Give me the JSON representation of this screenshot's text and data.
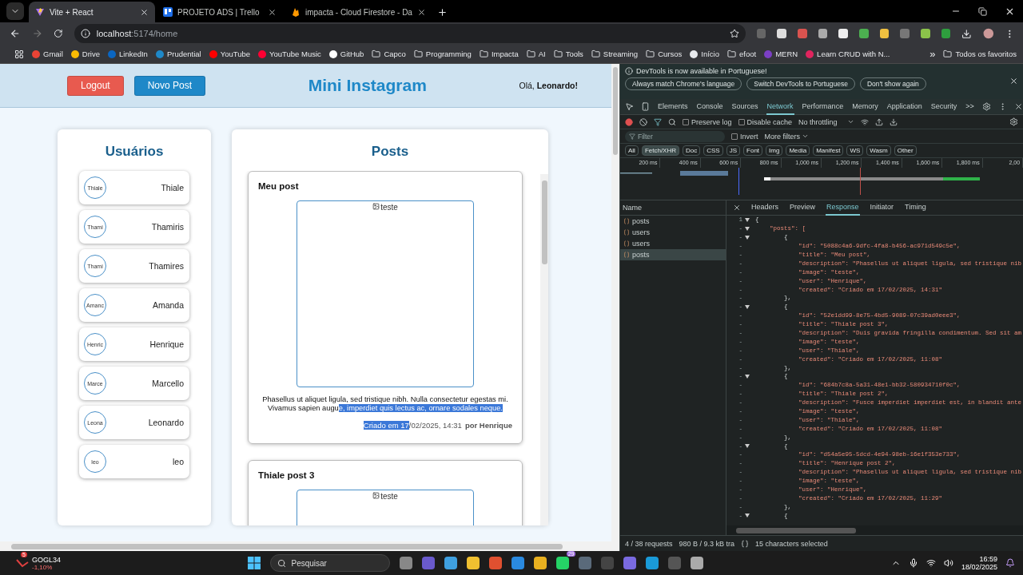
{
  "browser": {
    "tabs": [
      {
        "title": "Vite + React",
        "selected": true,
        "kind": "vite"
      },
      {
        "title": "PROJETO ADS | Trello",
        "selected": false,
        "kind": "trello"
      },
      {
        "title": "impacta - Cloud Firestore - Da",
        "selected": false,
        "kind": "firebase"
      }
    ],
    "address": {
      "host": "localhost",
      "path": ":5174/home"
    },
    "bookmarks": [
      {
        "label": "Gmail",
        "kind": "site",
        "color": "#ea4335"
      },
      {
        "label": "Drive",
        "kind": "site",
        "color": "#fbbc04"
      },
      {
        "label": "LinkedIn",
        "kind": "site",
        "color": "#0a66c2"
      },
      {
        "label": "Prudential",
        "kind": "site",
        "color": "#1e88c8"
      },
      {
        "label": "YouTube",
        "kind": "site",
        "color": "#ff0000"
      },
      {
        "label": "YouTube Music",
        "kind": "site",
        "color": "#ff0033"
      },
      {
        "label": "GitHub",
        "kind": "site",
        "color": "#ffffff"
      },
      {
        "label": "Capco",
        "kind": "folder"
      },
      {
        "label": "Programming",
        "kind": "folder"
      },
      {
        "label": "Impacta",
        "kind": "folder"
      },
      {
        "label": "AI",
        "kind": "folder"
      },
      {
        "label": "Tools",
        "kind": "folder"
      },
      {
        "label": "Streaming",
        "kind": "folder"
      },
      {
        "label": "Cursos",
        "kind": "folder"
      },
      {
        "label": "Início",
        "kind": "site",
        "color": "#e8eaed"
      },
      {
        "label": "efoot",
        "kind": "folder"
      },
      {
        "label": "MERN",
        "kind": "site",
        "color": "#7b3fc4"
      },
      {
        "label": "Learn CRUD with N...",
        "kind": "site",
        "color": "#e0245e"
      }
    ],
    "bookmarks_more": "»",
    "all_bookmarks": "Todos os favoritos"
  },
  "app": {
    "header": {
      "logout": "Logout",
      "new_post": "Novo Post",
      "title": "Mini Instagram",
      "greeting": "Olá, **Leonardo!**"
    },
    "users": {
      "title": "Usuários",
      "items": [
        {
          "name": "Thiale",
          "avatar_alt": "Thiale"
        },
        {
          "name": "Thamiris",
          "avatar_alt": "Thami"
        },
        {
          "name": "Thamires",
          "avatar_alt": "Thami"
        },
        {
          "name": "Amanda",
          "avatar_alt": "Amanc"
        },
        {
          "name": "Henrique",
          "avatar_alt": "Henric"
        },
        {
          "name": "Marcello",
          "avatar_alt": "Marce"
        },
        {
          "name": "Leonardo",
          "avatar_alt": "Leona"
        },
        {
          "name": "leo",
          "avatar_alt": "leo"
        }
      ]
    },
    "posts": {
      "title": "Posts",
      "items": [
        {
          "title": "Meu post",
          "image_alt": "teste",
          "description": "Phasellus ut aliquet ligula, sed tristique nibh. Nulla consectetur egestas mi. Vivamus sapien augu",
          "description_selected": "e, imperdiet quis lectus ac, ornare sodales neque.",
          "created_selected": "Criado em 17",
          "created_rest": "/02/2025, 14:31",
          "author": "por Henrique"
        },
        {
          "title": "Thiale post 3",
          "image_alt": "teste"
        }
      ]
    }
  },
  "devtools": {
    "banner": {
      "message": "DevTools is now available in Portuguese!",
      "buttons": [
        "Always match Chrome's language",
        "Switch DevTools to Portuguese",
        "Don't show again"
      ]
    },
    "tabs": [
      {
        "label": "Elements",
        "selected": false
      },
      {
        "label": "Console",
        "selected": false
      },
      {
        "label": "Sources",
        "selected": false
      },
      {
        "label": "Network",
        "selected": true
      },
      {
        "label": "Performance",
        "selected": false
      },
      {
        "label": "Memory",
        "selected": false
      },
      {
        "label": "Application",
        "selected": false
      },
      {
        "label": "Security",
        "selected": false
      }
    ],
    "tabs_more": ">>",
    "toolbar": {
      "preserve_log": {
        "label": "Preserve log",
        "checked": false
      },
      "disable_cache": {
        "label": "Disable cache",
        "checked": false
      },
      "throttling": "No throttling"
    },
    "filter": {
      "placeholder": "Filter",
      "invert": {
        "label": "Invert",
        "checked": false
      },
      "more_filters": "More filters"
    },
    "types": [
      {
        "label": "All",
        "selected": false
      },
      {
        "label": "Fetch/XHR",
        "selected": true
      },
      {
        "label": "Doc",
        "selected": false
      },
      {
        "label": "CSS",
        "selected": false
      },
      {
        "label": "JS",
        "selected": false
      },
      {
        "label": "Font",
        "selected": false
      },
      {
        "label": "Img",
        "selected": false
      },
      {
        "label": "Media",
        "selected": false
      },
      {
        "label": "Manifest",
        "selected": false
      },
      {
        "label": "WS",
        "selected": false
      },
      {
        "label": "Wasm",
        "selected": false
      },
      {
        "label": "Other",
        "selected": false
      }
    ],
    "timeline": {
      "ticks": [
        "200 ms",
        "400 ms",
        "600 ms",
        "800 ms",
        "1,000 ms",
        "1,200 ms",
        "1,400 ms",
        "1,600 ms",
        "1,800 ms",
        "2,00"
      ]
    },
    "requests": {
      "header": "Name",
      "items": [
        {
          "name": "posts",
          "selected": false
        },
        {
          "name": "users",
          "selected": false
        },
        {
          "name": "users",
          "selected": false
        },
        {
          "name": "posts",
          "selected": true
        }
      ]
    },
    "detail_tabs": [
      {
        "label": "Headers",
        "selected": false
      },
      {
        "label": "Preview",
        "selected": false
      },
      {
        "label": "Response",
        "selected": true
      },
      {
        "label": "Initiator",
        "selected": false
      },
      {
        "label": "Timing",
        "selected": false
      }
    ],
    "code": [
      {
        "number": "1",
        "fold": true,
        "kind": "brace",
        "text": "{"
      },
      {
        "number": "-",
        "fold": true,
        "kind": "pair",
        "text": "    \"posts\": ["
      },
      {
        "number": "-",
        "fold": true,
        "kind": "brace",
        "text": "        {"
      },
      {
        "number": "-",
        "fold": false,
        "kind": "pair",
        "text": "            \"id\": \"5088c4a6-9dfc-4fa8-b456-ac971d549c5e\","
      },
      {
        "number": "-",
        "fold": false,
        "kind": "pair",
        "text": "            \"title\": \"Meu post\","
      },
      {
        "number": "-",
        "fold": false,
        "kind": "pair",
        "text": "            \"description\": \"Phasellus ut aliquet ligula, sed tristique nib"
      },
      {
        "number": "-",
        "fold": false,
        "kind": "pair",
        "text": "            \"image\": \"teste\","
      },
      {
        "number": "-",
        "fold": false,
        "kind": "pair",
        "text": "            \"user\": \"Henrique\","
      },
      {
        "number": "-",
        "fold": false,
        "kind": "pair",
        "text": "            \"created\": \"Criado em 17/02/2025, 14:31\""
      },
      {
        "number": "-",
        "fold": false,
        "kind": "brace",
        "text": "        },"
      },
      {
        "number": "-",
        "fold": true,
        "kind": "brace",
        "text": "        {"
      },
      {
        "number": "-",
        "fold": false,
        "kind": "pair",
        "text": "            \"id\": \"52e1dd99-8e75-4bd5-9089-07c39ad0eee3\","
      },
      {
        "number": "-",
        "fold": false,
        "kind": "pair",
        "text": "            \"title\": \"Thiale post 3\","
      },
      {
        "number": "-",
        "fold": false,
        "kind": "pair",
        "text": "            \"description\": \"Duis gravida fringilla condimentum. Sed sit am"
      },
      {
        "number": "-",
        "fold": false,
        "kind": "pair",
        "text": "            \"image\": \"teste\","
      },
      {
        "number": "-",
        "fold": false,
        "kind": "pair",
        "text": "            \"user\": \"Thiale\","
      },
      {
        "number": "-",
        "fold": false,
        "kind": "pair",
        "text": "            \"created\": \"Criado em 17/02/2025, 11:08\""
      },
      {
        "number": "-",
        "fold": false,
        "kind": "brace",
        "text": "        },"
      },
      {
        "number": "-",
        "fold": true,
        "kind": "brace",
        "text": "        {"
      },
      {
        "number": "-",
        "fold": false,
        "kind": "pair",
        "text": "            \"id\": \"684b7c8a-5a31-48e1-bb32-580934710f0c\","
      },
      {
        "number": "-",
        "fold": false,
        "kind": "pair",
        "text": "            \"title\": \"Thiale post 2\","
      },
      {
        "number": "-",
        "fold": false,
        "kind": "pair",
        "text": "            \"description\": \"Fusce imperdiet imperdiet est, in blandit ante"
      },
      {
        "number": "-",
        "fold": false,
        "kind": "pair",
        "text": "            \"image\": \"teste\","
      },
      {
        "number": "-",
        "fold": false,
        "kind": "pair",
        "text": "            \"user\": \"Thiale\","
      },
      {
        "number": "-",
        "fold": false,
        "kind": "pair",
        "text": "            \"created\": \"Criado em 17/02/2025, 11:08\""
      },
      {
        "number": "-",
        "fold": false,
        "kind": "brace",
        "text": "        },"
      },
      {
        "number": "-",
        "fold": true,
        "kind": "brace",
        "text": "        {"
      },
      {
        "number": "-",
        "fold": false,
        "kind": "pair",
        "text": "            \"id\": \"d54a5e95-5dcd-4e94-98eb-16e1f353e733\","
      },
      {
        "number": "-",
        "fold": false,
        "kind": "pair",
        "text": "            \"title\": \"Henrique post 2\","
      },
      {
        "number": "-",
        "fold": false,
        "kind": "pair",
        "text": "            \"description\": \"Phasellus ut aliquet ligula, sed tristique nib"
      },
      {
        "number": "-",
        "fold": false,
        "kind": "pair",
        "text": "            \"image\": \"teste\","
      },
      {
        "number": "-",
        "fold": false,
        "kind": "pair",
        "text": "            \"user\": \"Henrique\","
      },
      {
        "number": "-",
        "fold": false,
        "kind": "pair",
        "text": "            \"created\": \"Criado em 17/02/2025, 11:29\""
      },
      {
        "number": "-",
        "fold": false,
        "kind": "brace",
        "text": "        },"
      },
      {
        "number": "-",
        "fold": true,
        "kind": "brace",
        "text": "        {"
      }
    ],
    "status": {
      "requests": "4 / 38 requests",
      "transferred": "980 B / 9.3 kB tra",
      "selection": "15 characters selected"
    }
  },
  "taskbar": {
    "stock": {
      "symbol": "GOGL34",
      "change": "-1,10%",
      "badge": "5"
    },
    "search": "Pesquisar",
    "whatsapp_badge": "29",
    "time": "16:59",
    "date": "18/02/2025"
  }
}
